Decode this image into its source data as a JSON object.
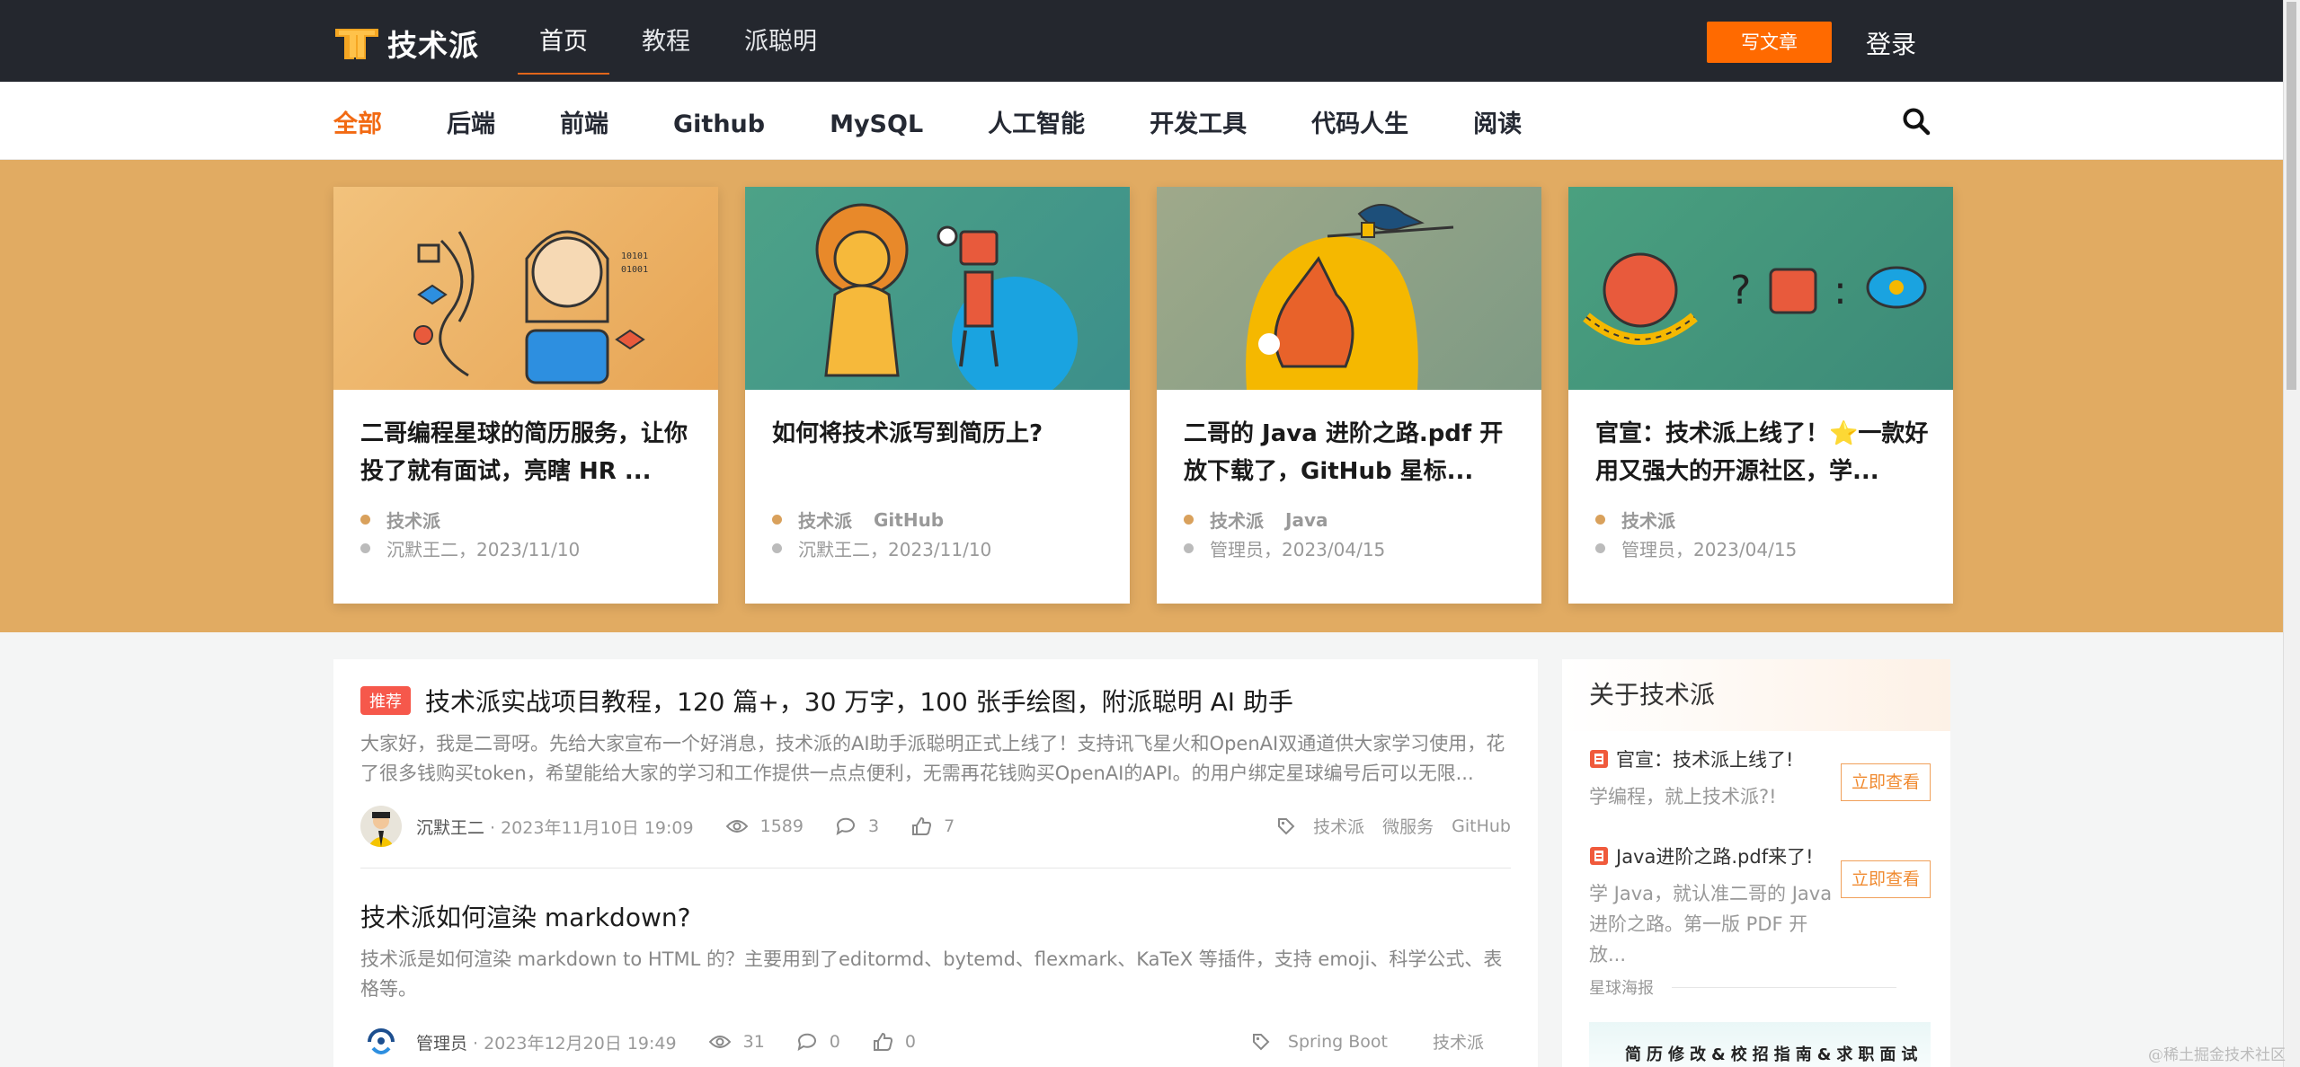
{
  "header": {
    "logo_text": "技术派",
    "nav": [
      "首页",
      "教程",
      "派聪明"
    ],
    "write_label": "写文章",
    "login_label": "登录"
  },
  "categories": [
    "全部",
    "后端",
    "前端",
    "Github",
    "MySQL",
    "人工智能",
    "开发工具",
    "代码人生",
    "阅读"
  ],
  "featured": [
    {
      "title": "二哥编程星球的简历服务，让你投了就有面试，亮瞎 HR ...",
      "tags": [
        "技术派"
      ],
      "meta": "沉默王二，2023/11/10"
    },
    {
      "title": "如何将技术派写到简历上?",
      "tags": [
        "技术派",
        "GitHub"
      ],
      "meta": "沉默王二，2023/11/10"
    },
    {
      "title": "二哥的 Java 进阶之路.pdf 开放下载了，GitHub 星标...",
      "tags": [
        "技术派",
        "Java"
      ],
      "meta": "管理员，2023/04/15"
    },
    {
      "title": "官宣：技术派上线了！⭐一款好用又强大的开源社区，学...",
      "tags": [
        "技术派"
      ],
      "meta": "管理员，2023/04/15"
    }
  ],
  "articles": [
    {
      "badge": "推荐",
      "title": "技术派实战项目教程，120 篇+，30 万字，100 张手绘图，附派聪明 AI 助手",
      "summary": "大家好，我是二哥呀。先给大家宣布一个好消息，技术派的AI助手派聪明正式上线了！支持讯飞星火和OpenAI双通道供大家学习使用，花了很多钱购买token，希望能给大家的学习和工作提供一点点便利，无需再花钱购买OpenAI的API。的用户绑定星球编号后可以无限...",
      "author": "沉默王二",
      "date": "· 2023年11月10日 19:09",
      "views": "1589",
      "comments": "3",
      "likes": "7",
      "tags": [
        "技术派",
        "微服务",
        "GitHub"
      ]
    },
    {
      "badge": "",
      "title": "技术派如何渲染 markdown?",
      "summary": "技术派是如何渲染 markdown to HTML 的？主要用到了editormd、bytemd、flexmark、KaTeX 等插件，支持 emoji、科学公式、表格等。",
      "author": "管理员",
      "date": "· 2023年12月20日 19:49",
      "views": "31",
      "comments": "0",
      "likes": "0",
      "tags": [
        "Spring Boot",
        "技术派"
      ]
    }
  ],
  "sidebar": {
    "title": "关于技术派",
    "promos": [
      {
        "title": "官宣：技术派上线了!",
        "desc": "学编程，就上技术派?!",
        "button": "立即查看"
      },
      {
        "title": "Java进阶之路.pdf来了!",
        "desc": "学 Java，就认准二哥的 Java 进阶之路。第一版 PDF 开放...",
        "button": "立即查看"
      }
    ],
    "poster_label": "星球海报",
    "poster_text": "简历修改&校招指南&求职面试"
  },
  "watermark": "@稀土掘金技术社区",
  "colors": {
    "accent": "#ff6a00",
    "banner": "#e1ab62",
    "topbar": "#24272e"
  }
}
